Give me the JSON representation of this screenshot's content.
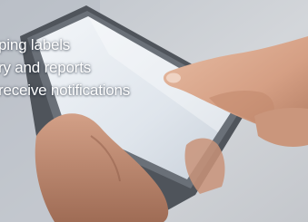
{
  "photo": {
    "subject": "hand-tapping-tablet",
    "colors": {
      "background": "#c9ccd1",
      "tablet_frame": "#5b6068",
      "tablet_screen": "#e7edf3",
      "skin": "#d9a58a",
      "skin_shadow": "#a9765d",
      "text": "#ffffff"
    }
  },
  "caption": {
    "lines": [
      "ping labels",
      "ry and reports",
      "receive notifications"
    ]
  }
}
